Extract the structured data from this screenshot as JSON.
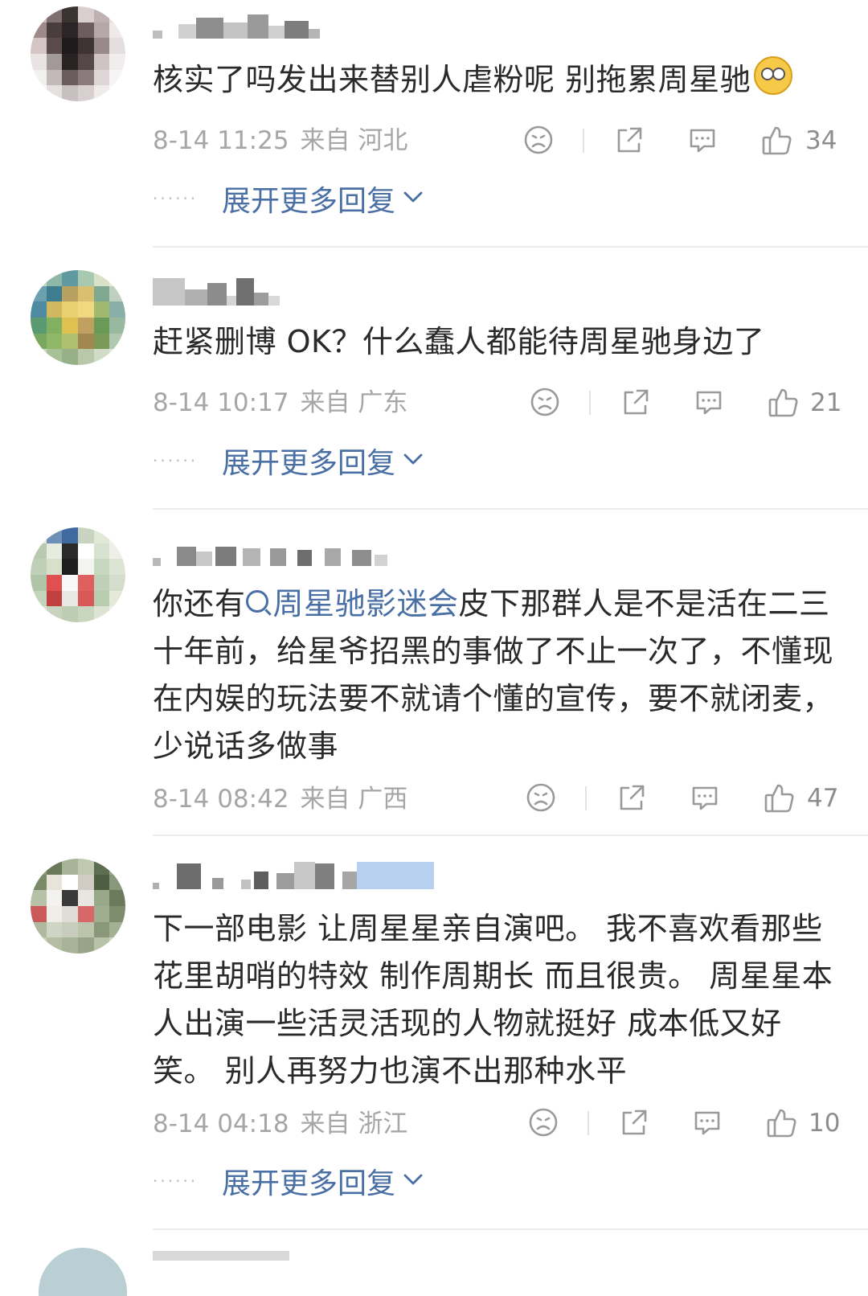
{
  "comments": [
    {
      "text": "核实了吗发出来替别人虐粉呢 别拖累周星驰",
      "time": "8-14 11:25",
      "location": "来自 河北",
      "likes": "34",
      "expand_label": "展开更多回复",
      "avatar_colors": [
        "#c7b7b6",
        "#7f6f70",
        "#3b3232",
        "#d9cfcf",
        "#bfb1b1",
        "#e8e0e0",
        "#9d8b8c",
        "#4a3d3e",
        "#2c2426",
        "#6e5d5f",
        "#b6a7a8",
        "#efeaea",
        "#d4c6c7",
        "#5b4b4d",
        "#1f1a1b",
        "#3d3234",
        "#9a898a",
        "#e5dede",
        "#e9e3e3",
        "#a3999a",
        "#2a2324",
        "#554748",
        "#cfc4c5",
        "#f1eded",
        "#f3f0f0",
        "#c2b9ba",
        "#6b5d5e",
        "#8b7b7c",
        "#ded5d6",
        "#f6f4f4",
        "#f8f7f7",
        "#e6e1e1",
        "#c8bfc0",
        "#d7cfd0",
        "#efebeb",
        "#fbfafa"
      ]
    },
    {
      "text": "赶紧删博 OK？什么蠢人都能待周星驰身边了",
      "time": "8-14 10:17",
      "location": "来自 广东",
      "likes": "21",
      "expand_label": "展开更多回复",
      "avatar_colors": [
        "#c8d8c0",
        "#8fb7a8",
        "#5f9aa0",
        "#a8c8b0",
        "#d8e0c8",
        "#e8ecd8",
        "#6aa0b0",
        "#3e7c90",
        "#b8a060",
        "#d8c070",
        "#7fa890",
        "#c0d0c0",
        "#4e8aa0",
        "#d0b860",
        "#e8d070",
        "#f0d880",
        "#a0b870",
        "#88b0a8",
        "#5a9a70",
        "#80b060",
        "#e0c050",
        "#c0a060",
        "#6a9a58",
        "#98b8a0",
        "#78a860",
        "#90b868",
        "#b0c070",
        "#a08850",
        "#7a9a58",
        "#b0c8b0",
        "#c8d8c8",
        "#a8c098",
        "#98b088",
        "#b8c8a8",
        "#d0dcc8",
        "#e0e8d8"
      ]
    },
    {
      "text_before": "你还有",
      "topic": "周星驰影迷会",
      "text_after": "皮下那群人是不是活在二三十年前，给星爷招黑的事做了不止一次了，不懂现在内娱的玩法要不就请个懂的宣传，要不就闭麦，少说话多做事",
      "time": "8-14 08:42",
      "location": "来自 广西",
      "likes": "47",
      "avatar_colors": [
        "#dfe6d8",
        "#6d8fb8",
        "#3f6aa0",
        "#c8d4c0",
        "#e0e8d8",
        "#f0f2ea",
        "#b8cbb0",
        "#e8ece0",
        "#2a2a2a",
        "#ffffff",
        "#d8e2d0",
        "#eef0e8",
        "#c0d0b8",
        "#d8e0cc",
        "#1e1e1e",
        "#f4f4f0",
        "#c8d8c0",
        "#dce4d4",
        "#b0c4a8",
        "#e05050",
        "#f8f8f8",
        "#e06060",
        "#c0d0b8",
        "#d4dccc",
        "#c4d4bc",
        "#c04040",
        "#e8e8e4",
        "#d85858",
        "#b8ccb0",
        "#e4ead8",
        "#d8e0d0",
        "#c8d4c0",
        "#bccdb4",
        "#c8d6c0",
        "#dce4d4",
        "#eef0e8"
      ]
    },
    {
      "text": "下一部电影 让周星星亲自演吧。 我不喜欢看那些花里胡哨的特效 制作周期长 而且很贵。 周星星本人出演一些活灵活现的人物就挺好 成本低又好笑。 别人再努力也演不出那种水平",
      "time": "8-14 04:18",
      "location": "来自 浙江",
      "likes": "10",
      "expand_label": "展开更多回复",
      "avatar_colors": [
        "#8a9a78",
        "#6a7a58",
        "#a8b498",
        "#c0c8b0",
        "#5e6e50",
        "#98a888",
        "#7a8a68",
        "#e8e4dc",
        "#ffffff",
        "#d0ccc4",
        "#4e5e40",
        "#88987a",
        "#b8c0a8",
        "#f4f2ee",
        "#3a3a3a",
        "#e8e6e0",
        "#9aa88a",
        "#6a7a5a",
        "#c85a5a",
        "#f0ece6",
        "#e0dcd6",
        "#d86868",
        "#a0ae90",
        "#7c8c6c",
        "#b0b8a0",
        "#d0d4c4",
        "#c8ccbc",
        "#bcc4ac",
        "#889878",
        "#a4b094",
        "#c4ccb4",
        "#b4bca4",
        "#a8b498",
        "#98a488",
        "#b8c2a8",
        "#cdd4c0"
      ]
    }
  ]
}
